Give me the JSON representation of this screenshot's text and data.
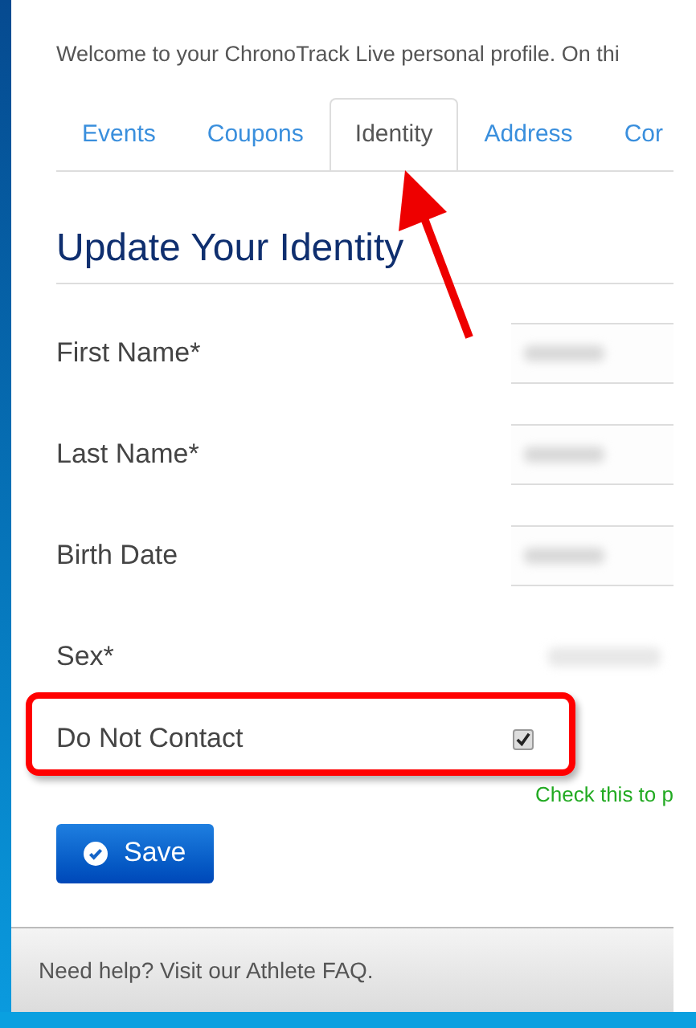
{
  "intro": "Welcome to your ChronoTrack Live personal profile. On thi",
  "tabs": [
    {
      "label": "Events",
      "selected": false
    },
    {
      "label": "Coupons",
      "selected": false
    },
    {
      "label": "Identity",
      "selected": true
    },
    {
      "label": "Address",
      "selected": false
    },
    {
      "label": "Cor",
      "selected": false
    }
  ],
  "heading": "Update Your Identity",
  "fields": [
    {
      "label": "First Name*",
      "kind": "text"
    },
    {
      "label": "Last Name*",
      "kind": "text"
    },
    {
      "label": "Birth Date",
      "kind": "text"
    },
    {
      "label": "Sex*",
      "kind": "select"
    },
    {
      "label": "Do Not Contact",
      "kind": "checkbox",
      "checked": true,
      "hint": "Check this to p"
    }
  ],
  "save_button": "Save",
  "footer": "Need help? Visit our Athlete FAQ."
}
